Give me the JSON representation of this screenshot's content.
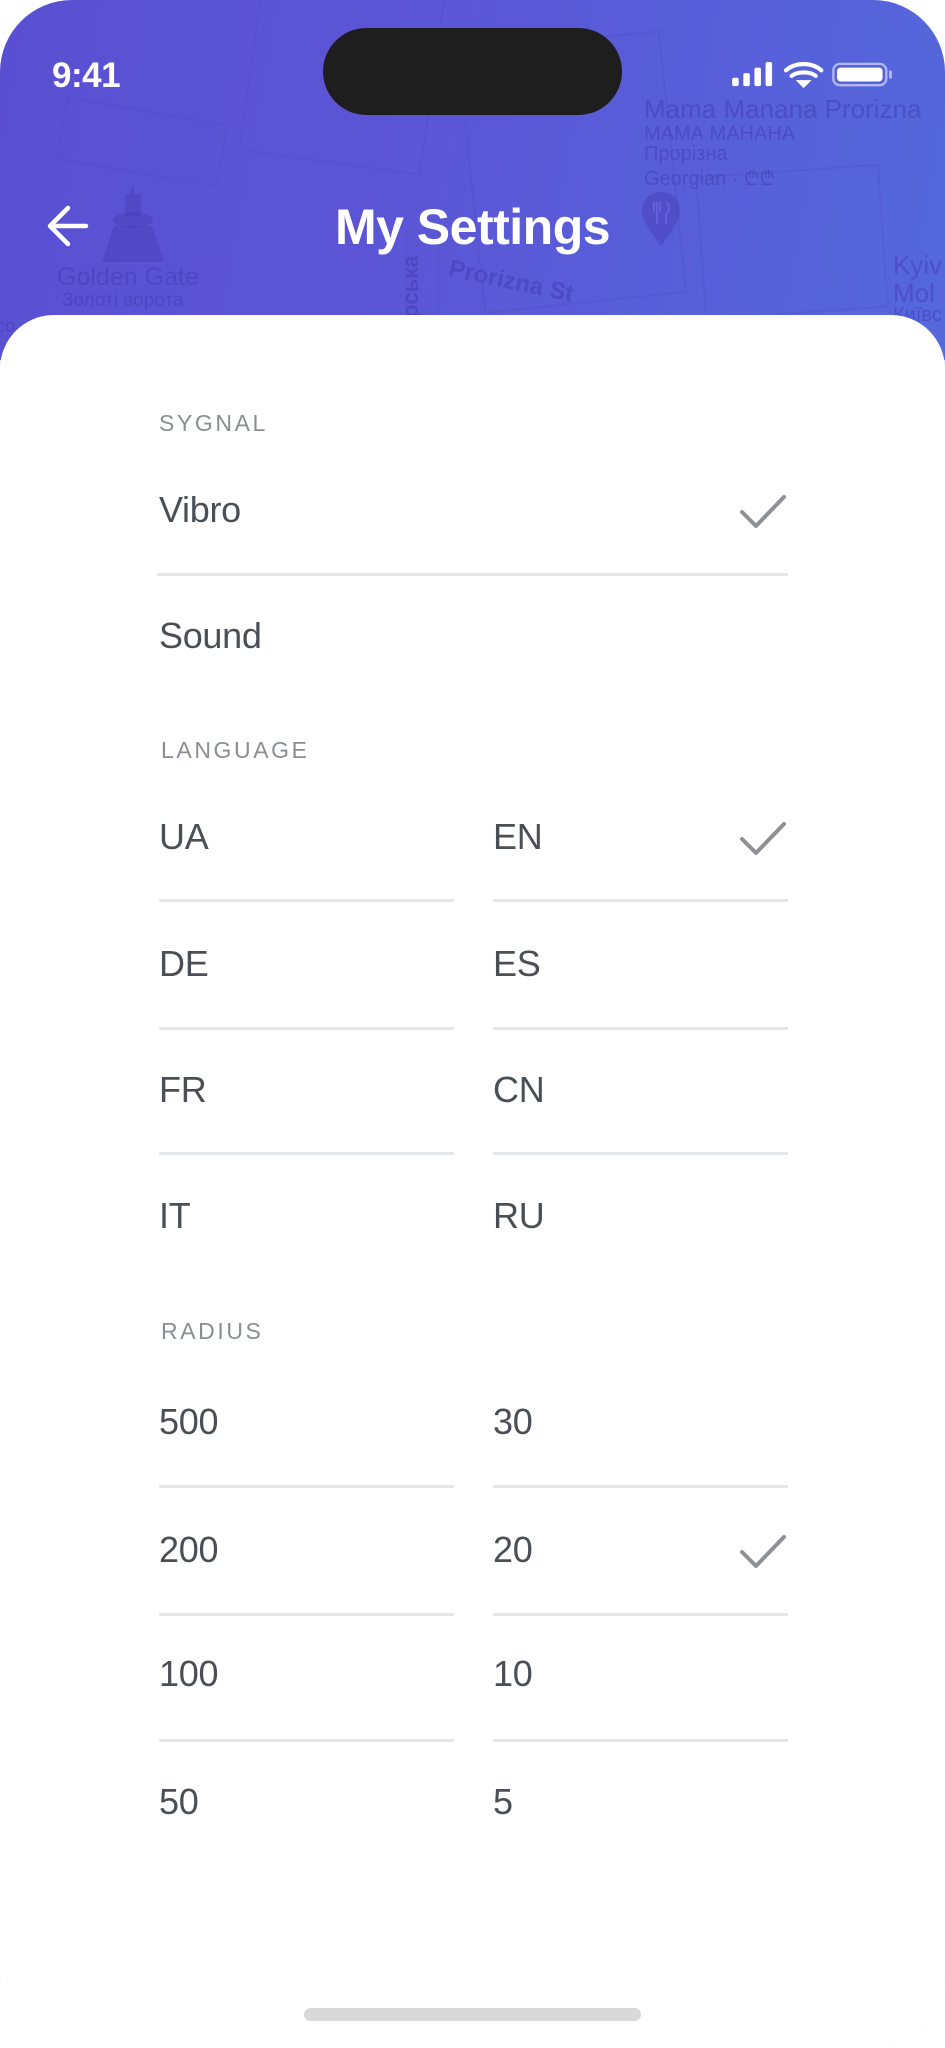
{
  "status_bar": {
    "time": "9:41",
    "icons": [
      "cellular-signal-icon",
      "wifi-icon",
      "battery-icon"
    ]
  },
  "map_background": {
    "labels": {
      "restaurant_name": "Mama Manana Prorizna",
      "restaurant_name_ua": "МАМА МАНАНА",
      "restaurant_street_ua": "Прорізна",
      "restaurant_cuisine": "Georgian · ₾₾",
      "landmark": "Golden Gate",
      "landmark_ua": "Золоті ворота",
      "street": "Prorizna St",
      "street_vertical": "рська",
      "edge_label_1": "Kyiv",
      "edge_label_2": "Mol",
      "edge_label_3": "Київс",
      "edge_label_left": "co"
    }
  },
  "header": {
    "title": "My Settings",
    "back_icon": "arrow-left-icon",
    "accent_gradient": [
      "#5a4fd2",
      "#5468dc"
    ]
  },
  "sections": {
    "signal": {
      "label": "SYGNAL",
      "options": [
        {
          "label": "Vibro",
          "selected": true
        },
        {
          "label": "Sound",
          "selected": false
        }
      ]
    },
    "language": {
      "label": "LANGUAGE",
      "options": [
        {
          "label": "UA",
          "selected": false
        },
        {
          "label": "EN",
          "selected": true
        },
        {
          "label": "DE",
          "selected": false
        },
        {
          "label": "ES",
          "selected": false
        },
        {
          "label": "FR",
          "selected": false
        },
        {
          "label": "CN",
          "selected": false
        },
        {
          "label": "IT",
          "selected": false
        },
        {
          "label": "RU",
          "selected": false
        }
      ]
    },
    "radius": {
      "label": "RADIUS",
      "options": [
        {
          "label": "500",
          "selected": false
        },
        {
          "label": "30",
          "selected": false
        },
        {
          "label": "200",
          "selected": false
        },
        {
          "label": "20",
          "selected": true
        },
        {
          "label": "100",
          "selected": false
        },
        {
          "label": "10",
          "selected": false
        },
        {
          "label": "50",
          "selected": false
        },
        {
          "label": "5",
          "selected": false
        }
      ]
    }
  },
  "colors": {
    "text": "#4a4f56",
    "section_label": "#8a8e93",
    "checkmark": "#8e9094",
    "divider": "#e3e6ea"
  }
}
